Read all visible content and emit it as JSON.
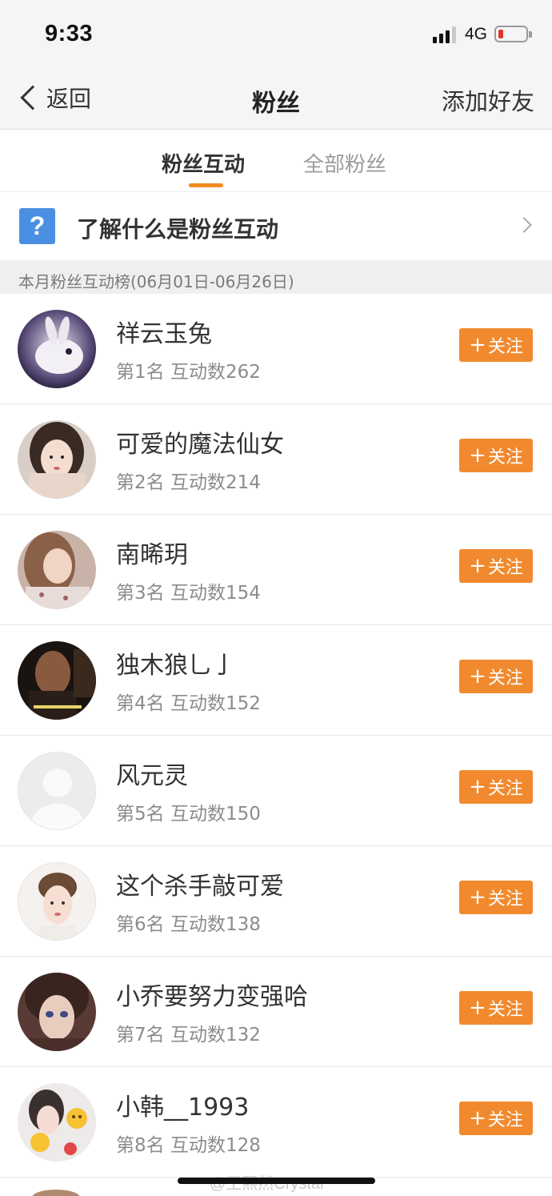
{
  "status_bar": {
    "time": "9:33",
    "network": "4G",
    "battery_level": 0.1,
    "battery_color": "#e2352b"
  },
  "nav": {
    "back_label": "返回",
    "title": "粉丝",
    "right_action": "添加好友"
  },
  "tabs": [
    {
      "label": "粉丝互动",
      "active": true
    },
    {
      "label": "全部粉丝",
      "active": false
    }
  ],
  "info_row": {
    "icon": "help-icon",
    "icon_glyph": "?",
    "label": "了解什么是粉丝互动"
  },
  "section_header": "本月粉丝互动榜(06月01日-06月26日)",
  "follow_label": "关注",
  "follow_plus": "+",
  "accent_color": "#f18a2e",
  "fans": [
    {
      "name": "祥云玉兔",
      "rank_text": "第1名 互动数262"
    },
    {
      "name": "可爱的魔法仙女",
      "rank_text": "第2名 互动数214"
    },
    {
      "name": "南晞玥",
      "rank_text": "第3名 互动数154"
    },
    {
      "name": "独木狼乚亅",
      "rank_text": "第4名 互动数152"
    },
    {
      "name": "风元灵",
      "rank_text": "第5名 互动数150"
    },
    {
      "name": "这个杀手敲可爱",
      "rank_text": "第6名 互动数138"
    },
    {
      "name": "小乔要努力变强哈",
      "rank_text": "第7名 互动数132"
    },
    {
      "name": "小韩__1993",
      "rank_text": "第8名 互动数128"
    }
  ],
  "watermark": "@王熙然Crystal"
}
